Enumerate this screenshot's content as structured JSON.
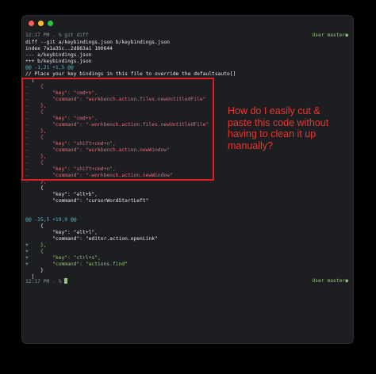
{
  "terminal": {
    "prompt1_left": "12:17 PM . % git diff",
    "prompt1_right": "User master●",
    "diff_header": [
      "diff --git a/keybindings.json b/keybindings.json",
      "index 7a1a35c..2d863a1 100644",
      "--- a/keybindings.json",
      "+++ b/keybindings.json"
    ],
    "hunk1": "@@ -1,21 +1,5 @@",
    "comment": "// Place your key bindings in this file to override the defaultsauto[]",
    "lines": [
      {
        "t": "  [",
        "c": "ctx"
      },
      {
        "t": "-    {",
        "c": "del"
      },
      {
        "t": "-        \"key\": \"cmd+n\",",
        "c": "del"
      },
      {
        "t": "-        \"command\": \"workbench.action.files.newUntitledFile\"",
        "c": "del"
      },
      {
        "t": "-    },",
        "c": "del"
      },
      {
        "t": "-    {",
        "c": "del"
      },
      {
        "t": "-        \"key\": \"cmd+n\",",
        "c": "del"
      },
      {
        "t": "-        \"command\": \"-workbench.action.files.newUntitledFile\"",
        "c": "del"
      },
      {
        "t": "-    },",
        "c": "del"
      },
      {
        "t": "-    {",
        "c": "del"
      },
      {
        "t": "-        \"key\": \"shift+cmd+n\",",
        "c": "del"
      },
      {
        "t": "-        \"command\": \"workbench.action.newWindow\"",
        "c": "del"
      },
      {
        "t": "-    },",
        "c": "del"
      },
      {
        "t": "-    {",
        "c": "del"
      },
      {
        "t": "-        \"key\": \"shift+cmd+n\",",
        "c": "del"
      },
      {
        "t": "-        \"command\": \"-workbench.action.newWindow\"",
        "c": "del"
      },
      {
        "t": "-    },",
        "c": "del"
      },
      {
        "t": "     {",
        "c": "ctx"
      },
      {
        "t": "         \"key\": \"alt+b\",",
        "c": "ctx"
      },
      {
        "t": "         \"command\": \"cursorWordStartLeft\"",
        "c": "ctx"
      }
    ],
    "hunk2": "@@ -35,5 +19,9 @@",
    "lines2": [
      {
        "t": "     {",
        "c": "ctx"
      },
      {
        "t": "         \"key\": \"alt+l\",",
        "c": "ctx"
      },
      {
        "t": "         \"command\": \"editor.action.openLink\"",
        "c": "ctx"
      },
      {
        "t": "+    },",
        "c": "add"
      },
      {
        "t": "+    {",
        "c": "add"
      },
      {
        "t": "+        \"key\": \"ctrl+s\",",
        "c": "add"
      },
      {
        "t": "+        \"command\": \"actions.find\"",
        "c": "add"
      },
      {
        "t": "     }",
        "c": "ctx"
      },
      {
        "t": "  ]",
        "c": "ctx"
      }
    ],
    "prompt2_left": "12:17 PM . % ",
    "prompt2_right": "User master●"
  },
  "annotation": {
    "text": "How do I easily cut & paste this code without having to clean it up manually?",
    "color": "#e8382f"
  }
}
